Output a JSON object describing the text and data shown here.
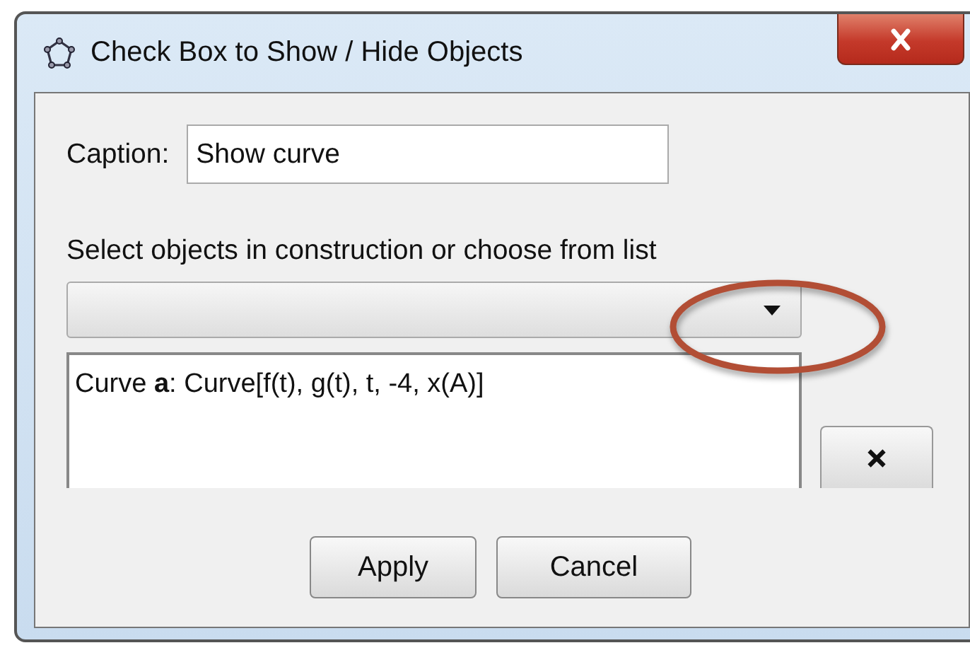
{
  "window": {
    "title": "Check Box to Show / Hide Objects"
  },
  "caption": {
    "label": "Caption:",
    "value": "Show curve"
  },
  "select_label": "Select objects in construction or choose from list",
  "objects": [
    "Curve **a**: Curve[f(t), g(t), t, -4, x(A)]"
  ],
  "buttons": [
    "Apply",
    "Cancel"
  ]
}
